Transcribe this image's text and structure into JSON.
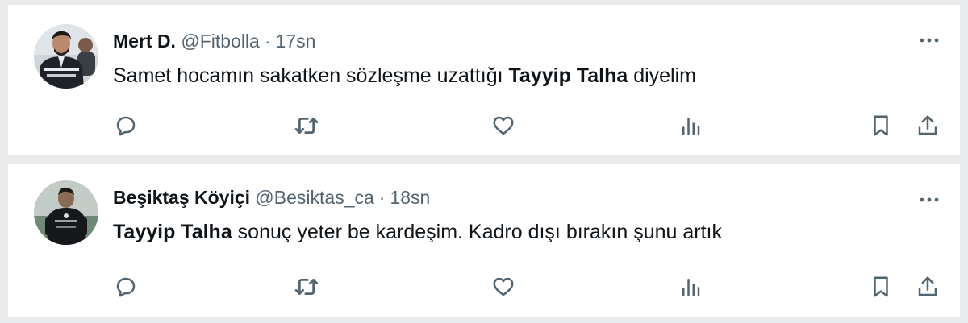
{
  "colors": {
    "background": "#e8eaec",
    "card": "#ffffff",
    "text": "#0f1419",
    "muted": "#536471"
  },
  "tweets": [
    {
      "display_name": "Mert D.",
      "handle": "@Fitbolla",
      "separator": "·",
      "time": "17sn",
      "text_before": "Samet hocamın sakatken sözleşme uzattığı ",
      "bold": "Tayyip Talha",
      "text_after": " diyelim",
      "avatar": "profile-photo-man-in-tracksuit",
      "icons": [
        "reply-icon",
        "retweet-icon",
        "like-icon",
        "views-icon",
        "bookmark-icon",
        "share-icon",
        "more-icon"
      ]
    },
    {
      "display_name": "Beşiktaş Köyiçi",
      "handle": "@Besiktas_ca",
      "separator": "·",
      "time": "18sn",
      "text_before": "",
      "bold": "Tayyip Talha",
      "text_after": " sonuç yeter be kardeşim. Kadro dışı bırakın şunu artık",
      "avatar": "profile-photo-goalkeeper",
      "icons": [
        "reply-icon",
        "retweet-icon",
        "like-icon",
        "views-icon",
        "bookmark-icon",
        "share-icon",
        "more-icon"
      ]
    }
  ]
}
